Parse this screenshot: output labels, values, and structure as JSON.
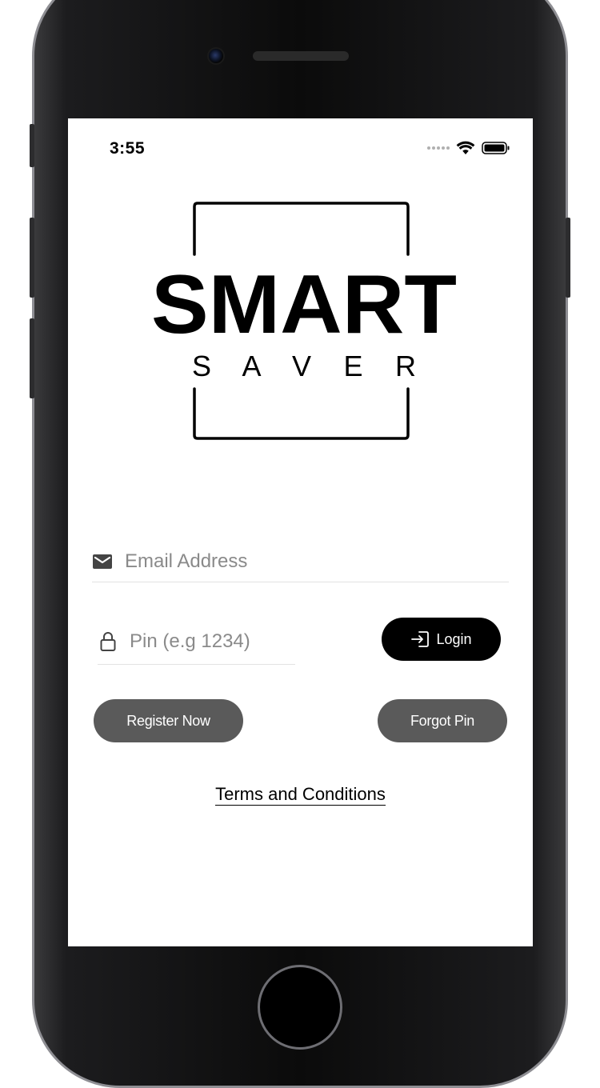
{
  "status_bar": {
    "time": "3:55",
    "wifi_icon": "wifi-icon",
    "battery_icon": "battery-icon"
  },
  "logo": {
    "word": "SMART",
    "subword": "S A V E R"
  },
  "form": {
    "email_placeholder": "Email Address",
    "pin_placeholder": "Pin (e.g 1234)",
    "login_label": "Login",
    "register_label": "Register Now",
    "forgot_label": "Forgot Pin",
    "terms_label": "Terms and Conditions"
  },
  "colors": {
    "primary": "#000000",
    "secondary_button": "#5a5a5a",
    "placeholder": "#8a8a8a"
  }
}
